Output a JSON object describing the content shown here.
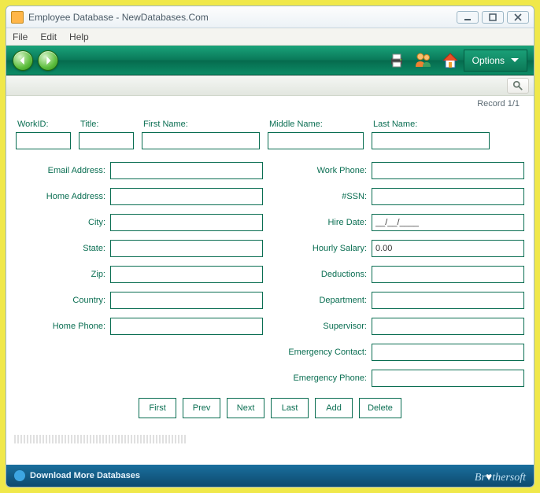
{
  "window": {
    "title": "Employee Database - NewDatabases.Com"
  },
  "menu": {
    "file": "File",
    "edit": "Edit",
    "help": "Help"
  },
  "toolbar": {
    "options": "Options"
  },
  "record_counter": "Record 1/1",
  "labels": {
    "workid": "WorkID:",
    "title": "Title:",
    "first_name": "First Name:",
    "middle_name": "Middle Name:",
    "last_name": "Last Name:",
    "email": "Email Address:",
    "home_address": "Home Address:",
    "city": "City:",
    "state": "State:",
    "zip": "Zip:",
    "country": "Country:",
    "home_phone": "Home Phone:",
    "work_phone": "Work Phone:",
    "ssn": "#SSN:",
    "hire_date": "Hire Date:",
    "hourly_salary": "Hourly Salary:",
    "deductions": "Deductions:",
    "department": "Department:",
    "supervisor": "Supervisor:",
    "emergency_contact": "Emergency Contact:",
    "emergency_phone": "Emergency Phone:"
  },
  "values": {
    "workid": "",
    "title": "",
    "first_name": "",
    "middle_name": "",
    "last_name": "",
    "email": "",
    "home_address": "",
    "city": "",
    "state": "",
    "zip": "",
    "country": "",
    "home_phone": "",
    "work_phone": "",
    "ssn": "",
    "hire_date": "__/__/____",
    "hourly_salary": "0.00",
    "deductions": "",
    "department": "",
    "supervisor": "",
    "emergency_contact": "",
    "emergency_phone": ""
  },
  "nav": {
    "first": "First",
    "prev": "Prev",
    "next": "Next",
    "last": "Last",
    "add": "Add",
    "delete": "Delete"
  },
  "status": {
    "download": "Download More Databases",
    "brand_plain": "Br",
    "brand_mid": "♥",
    "brand_end": "thersoft"
  }
}
